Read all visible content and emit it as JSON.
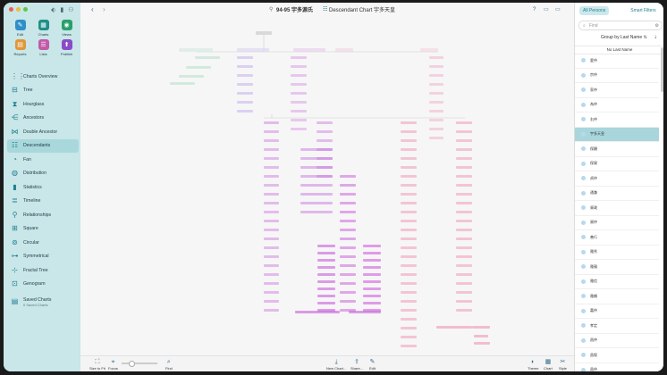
{
  "window": {
    "title": "94-95 宇多源氏",
    "chart_title": "Descendant Chart 宇多天皇"
  },
  "colors": {
    "sidebar_bg": "#c9e6e8",
    "accent": "#1e7f92",
    "selection": "#a9d6dc"
  },
  "sidebar": {
    "grid": [
      {
        "label": "Edit",
        "icon": "pencil-icon",
        "color": "#2f8fc9",
        "glyph": "✎"
      },
      {
        "label": "Charts",
        "icon": "charts-icon",
        "color": "#1e8f86",
        "glyph": "▦"
      },
      {
        "label": "Views",
        "icon": "eye-icon",
        "color": "#27a06a",
        "glyph": "◉"
      },
      {
        "label": "Reports",
        "icon": "reports-icon",
        "color": "#e0973a",
        "glyph": "▤"
      },
      {
        "label": "Lists",
        "icon": "lists-icon",
        "color": "#c25aa8",
        "glyph": "☰"
      },
      {
        "label": "Publish",
        "icon": "publish-icon",
        "color": "#8a4cc9",
        "glyph": "⬆"
      }
    ],
    "nav": [
      {
        "label": "Charts Overview",
        "icon": "overview-icon",
        "glyph": "⋮⋮"
      },
      {
        "label": "Tree",
        "icon": "tree-icon",
        "glyph": "⊟"
      },
      {
        "label": "Hourglass",
        "icon": "hourglass-icon",
        "glyph": "⧗"
      },
      {
        "label": "Ancestors",
        "icon": "ancestors-icon",
        "glyph": "⋲"
      },
      {
        "label": "Double Ancestor",
        "icon": "double-ancestor-icon",
        "glyph": "⋈"
      },
      {
        "label": "Descendants",
        "icon": "descendants-icon",
        "glyph": "☷"
      },
      {
        "label": "Fan",
        "icon": "fan-icon",
        "glyph": "◔"
      },
      {
        "label": "Distribution",
        "icon": "distribution-icon",
        "glyph": "◍"
      },
      {
        "label": "Statistics",
        "icon": "statistics-icon",
        "glyph": "▮"
      },
      {
        "label": "Timeline",
        "icon": "timeline-icon",
        "glyph": "≣"
      },
      {
        "label": "Relationships",
        "icon": "relationships-icon",
        "glyph": "⚲"
      },
      {
        "label": "Square",
        "icon": "square-icon",
        "glyph": "⊞"
      },
      {
        "label": "Circular",
        "icon": "circular-icon",
        "glyph": "⊚"
      },
      {
        "label": "Symmetrical",
        "icon": "symmetrical-icon",
        "glyph": "⊶"
      },
      {
        "label": "Fractal Tree",
        "icon": "fractal-tree-icon",
        "glyph": "⊹"
      },
      {
        "label": "Genogram",
        "icon": "genogram-icon",
        "glyph": "⊡"
      },
      {
        "label": "Saved Charts",
        "icon": "saved-charts-icon",
        "glyph": "▤",
        "sub": "0 Saved Charts"
      }
    ]
  },
  "bottombar": [
    {
      "label": "Size to Fit",
      "icon": "size-to-fit-icon",
      "glyph": "⛶"
    },
    {
      "label": "Focus",
      "icon": "focus-icon",
      "glyph": "⌖"
    },
    {
      "label": "Find",
      "icon": "find-icon",
      "glyph": "⌕"
    },
    {
      "label": "New Chart...",
      "icon": "new-chart-icon",
      "glyph": "⤓"
    },
    {
      "label": "Share...",
      "icon": "share-icon",
      "glyph": "⇪"
    },
    {
      "label": "Edit",
      "icon": "edit-icon",
      "glyph": "✎"
    },
    {
      "label": "Theme",
      "icon": "theme-icon",
      "glyph": "◐"
    },
    {
      "label": "Chart",
      "icon": "chart-icon",
      "glyph": "▦"
    },
    {
      "label": "Style",
      "icon": "style-icon",
      "glyph": "✂"
    }
  ],
  "right_panel": {
    "tab_all": "All Persons",
    "tab_smart": "Smart Filters",
    "find_placeholder": "Find",
    "group_by": "Group by Last Name",
    "section": "No Last Name",
    "persons": [
      "愛仲",
      "宗仲",
      "家仲",
      "為仲",
      "右仲",
      "宇多天皇",
      "保顕",
      "保資",
      "貞仲",
      "通兼",
      "資政",
      "資仲",
      "善行",
      "雅秀",
      "雅親",
      "雅信",
      "雅頼",
      "嘉仲",
      "孝定",
      "昌仲",
      "昌叙",
      "昌仲"
    ],
    "selected_index": 5
  }
}
